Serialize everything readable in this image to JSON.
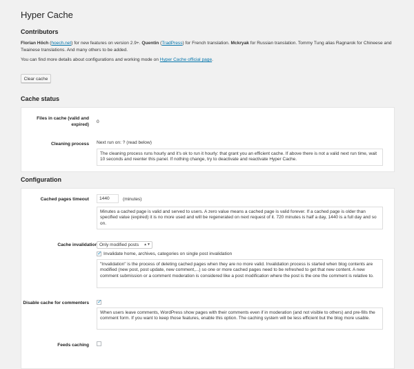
{
  "page_title": "Hyper Cache",
  "contributors": {
    "heading": "Contributors",
    "credits": {
      "n1": "Florian Höch",
      "l1": "hoech.net",
      "t1": " for new features on version 2.9+. ",
      "n2": "Quentin",
      "l2": "TradPress",
      "t2": " for French translation. ",
      "n3": "Mckryak",
      "t3": " for Russian translation. Tommy Tung alias Ragnarok for Chineese and Twainese translations. And many others to be added."
    },
    "details_prefix": "You can find more details about configurations and working mode on ",
    "details_link": "Hyper Cache official page",
    "details_suffix": ".",
    "clear_cache_label": "Clear cache"
  },
  "cache_status": {
    "heading": "Cache status",
    "files_label": "Files in cache (valid and expired)",
    "files_value": "0",
    "cleaning_label": "Cleaning process",
    "cleaning_value": "Next run on: ? (read below)",
    "cleaning_desc": "The cleaning process runs hourly and it's ok to run it hourly: that grant you an efficient cache. If above there is not a valid next run time, wait 10 seconds and reenter this panel. If nothing change, try to deactivate and reactivate Hyper Cache."
  },
  "configuration": {
    "heading": "Configuration",
    "timeout_label": "Cached pages timeout",
    "timeout_value": "1440",
    "timeout_unit": "(minutes)",
    "timeout_desc": "Minutes a cached page is valid and served to users. A zero value means a cached page is valid forever. If a cached page is older than specified value (expired) it is no more used and will be regenerated on next request of it. 720 minutes is half a day, 1440 is a full day and so on.",
    "invalidation_label": "Cache invalidation mode",
    "invalidation_selected": "Only modified posts",
    "invalidation_checkbox_label": "Invalidate home, archives, categories on single post invalidation",
    "invalidation_desc": "\"Invalidation\" is the process of deleting cached pages when they are no more valid. Invalidation process is started when blog contents are modified (new post, post update, new comment,...) so one or more cached pages need to be refreshed to get that new content. A new comment submission or a comment moderation is considered like a post modification where the post is the one the comment is relative to.",
    "disable_commenters_label": "Disable cache for commenters",
    "disable_commenters_desc": "When users leave comments, WordPress show pages with their comments even if in moderation (and not visible to others) and pre-fills the comment form. If you want to keep those features, enable this option. The caching system will be less efficient but the blog more usable.",
    "feeds_label": "Feeds caching"
  },
  "colors": {
    "link": "#0073aa",
    "checkmark": "#1e8cbe",
    "background": "#f1f1f1"
  }
}
